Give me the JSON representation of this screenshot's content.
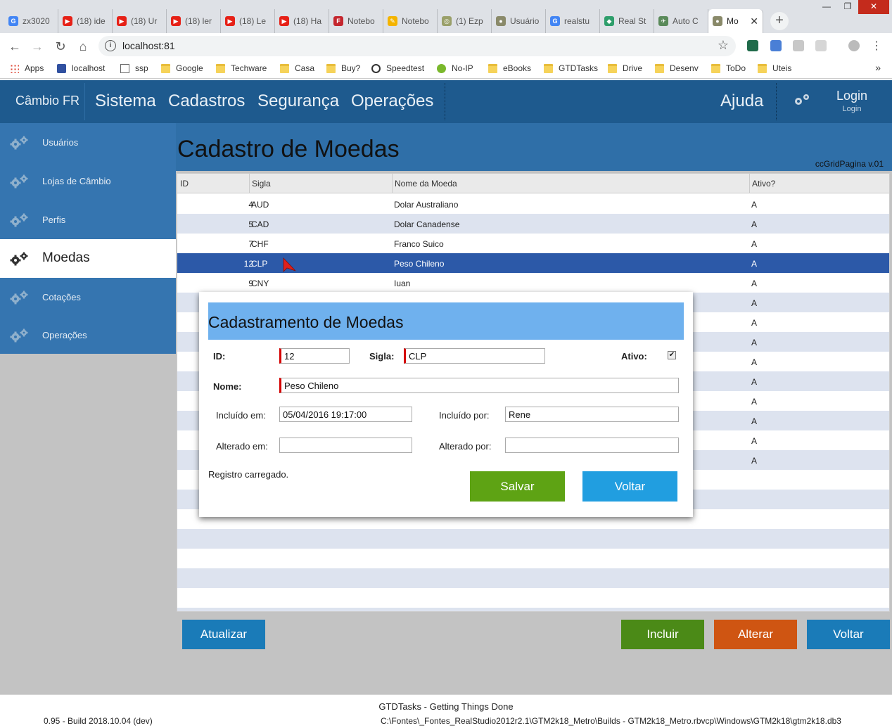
{
  "browser": {
    "window_controls": [
      "—",
      "❐",
      "✕"
    ],
    "tabs": [
      {
        "label": "zx3020",
        "fav_color": "#4285f4",
        "fav_glyph": "G"
      },
      {
        "label": "(18) ide",
        "fav_color": "#e62117",
        "fav_glyph": "▶"
      },
      {
        "label": "(18) Ur",
        "fav_color": "#e62117",
        "fav_glyph": "▶"
      },
      {
        "label": "(18) ler",
        "fav_color": "#e62117",
        "fav_glyph": "▶"
      },
      {
        "label": "(18) Le",
        "fav_color": "#e62117",
        "fav_glyph": "▶"
      },
      {
        "label": "(18) Ha",
        "fav_color": "#e62117",
        "fav_glyph": "▶"
      },
      {
        "label": "Notebo",
        "fav_color": "#c4262e",
        "fav_glyph": "F"
      },
      {
        "label": "Notebo",
        "fav_color": "#f4b400",
        "fav_glyph": "✎"
      },
      {
        "label": "(1) Ezp",
        "fav_color": "#9aa06a",
        "fav_glyph": "◎"
      },
      {
        "label": "Usuário",
        "fav_color": "#8a8a6a",
        "fav_glyph": "●"
      },
      {
        "label": "realstu",
        "fav_color": "#4285f4",
        "fav_glyph": "G"
      },
      {
        "label": "Real St",
        "fav_color": "#2e9e6b",
        "fav_glyph": "◆"
      },
      {
        "label": "Auto C",
        "fav_color": "#5a8a5a",
        "fav_glyph": "✈"
      },
      {
        "label": "Mo",
        "fav_color": "#8a8a6a",
        "fav_glyph": "●",
        "active": true
      }
    ],
    "new_tab": "+",
    "tab_close": "✕",
    "url": "localhost:81",
    "bookmarks": [
      {
        "label": "Apps",
        "type": "appsgrid"
      },
      {
        "label": "localhost",
        "type": "logo"
      },
      {
        "label": "ssp",
        "type": "page"
      },
      {
        "label": "Google",
        "type": "folder"
      },
      {
        "label": "Techware",
        "type": "folder"
      },
      {
        "label": "Casa",
        "type": "folder"
      },
      {
        "label": "Buy?",
        "type": "folder"
      },
      {
        "label": "Speedtest",
        "type": "speed"
      },
      {
        "label": "No-IP",
        "type": "noip"
      },
      {
        "label": "eBooks",
        "type": "folder"
      },
      {
        "label": "GTDTasks",
        "type": "folder"
      },
      {
        "label": "Drive",
        "type": "folder"
      },
      {
        "label": "Desenv",
        "type": "folder"
      },
      {
        "label": "ToDo",
        "type": "folder"
      },
      {
        "label": "Uteis",
        "type": "folder"
      }
    ],
    "bookmarks_more": "»"
  },
  "app": {
    "brand": "Câmbio FR",
    "menu": [
      "Sistema",
      "Cadastros",
      "Segurança",
      "Operações"
    ],
    "help": "Ajuda",
    "login_title": "Login",
    "login_sub": "Login",
    "colors": {
      "header": "#1e5a8e",
      "sidebar": "#3575b0",
      "title_band": "#2f6fa8",
      "selected_row": "#2c59a8"
    }
  },
  "sidebar": {
    "items": [
      {
        "label": "Usuários",
        "active": false
      },
      {
        "label": "Lojas de Câmbio",
        "active": false
      },
      {
        "label": "Perfis",
        "active": false
      },
      {
        "label": "Moedas",
        "active": true
      },
      {
        "label": "Cotações",
        "active": false
      },
      {
        "label": "Operações",
        "active": false
      }
    ]
  },
  "page": {
    "title": "Cadastro de Moedas",
    "grid_version": "ccGridPagina v.01"
  },
  "grid": {
    "columns": [
      "ID",
      "Sigla",
      "Nome da Moeda",
      "Ativo?"
    ],
    "rows": [
      {
        "id": "4",
        "sigla": "AUD",
        "nome": "Dolar Australiano",
        "ativo": "A"
      },
      {
        "id": "5",
        "sigla": "CAD",
        "nome": "Dolar Canadense",
        "ativo": "A"
      },
      {
        "id": "7",
        "sigla": "CHF",
        "nome": "Franco Suico",
        "ativo": "A"
      },
      {
        "id": "12",
        "sigla": "CLP",
        "nome": "Peso Chileno",
        "ativo": "A",
        "selected": true
      },
      {
        "id": "9",
        "sigla": "CNY",
        "nome": "Iuan",
        "ativo": "A"
      },
      {
        "id": "",
        "sigla": "",
        "nome": "",
        "ativo": "A"
      },
      {
        "id": "",
        "sigla": "",
        "nome": "",
        "ativo": "A"
      },
      {
        "id": "",
        "sigla": "",
        "nome": "",
        "ativo": "A"
      },
      {
        "id": "",
        "sigla": "",
        "nome": "",
        "ativo": "A"
      },
      {
        "id": "",
        "sigla": "",
        "nome": "",
        "ativo": "A"
      },
      {
        "id": "",
        "sigla": "",
        "nome": "",
        "ativo": "A"
      },
      {
        "id": "",
        "sigla": "",
        "nome": "",
        "ativo": "A"
      },
      {
        "id": "",
        "sigla": "",
        "nome": "",
        "ativo": "A"
      },
      {
        "id": "",
        "sigla": "",
        "nome": "",
        "ativo": "A"
      }
    ],
    "blank_rows": 8
  },
  "actions": {
    "refresh": "Atualizar",
    "add": "Incluir",
    "edit": "Alterar",
    "back": "Voltar",
    "colors": {
      "refresh": "#1a7bb8",
      "add": "#4b8a17",
      "edit": "#cf5512",
      "back": "#1a7bb8"
    }
  },
  "modal": {
    "title": "Cadastramento de Moedas",
    "id_label": "ID:",
    "id_value": "12",
    "sigla_label": "Sigla:",
    "sigla_value": "CLP",
    "ativo_label": "Ativo:",
    "ativo_checked": true,
    "check_glyph": "✔",
    "nome_label": "Nome:",
    "nome_value": "Peso Chileno",
    "incluido_em_label": "Incluído em:",
    "incluido_em_value": "05/04/2016 19:17:00",
    "incluido_por_label": "Incluído por:",
    "incluido_por_value": "Rene",
    "alterado_em_label": "Alterado em:",
    "alterado_em_value": "",
    "alterado_por_label": "Alterado por:",
    "alterado_por_value": "",
    "status": "Registro carregado.",
    "save": "Salvar",
    "back": "Voltar",
    "colors": {
      "header": "#6fb1ee",
      "save": "#5ea314",
      "back": "#219ee0",
      "required_marker": "#d40000"
    }
  },
  "footer": {
    "app_name": "GTDTasks - Getting Things Done",
    "version": "0.95 - Build 2018.10.04 (dev)",
    "db_path": "C:\\Fontes\\_Fontes_RealStudio2012r2.1\\GTM2k18_Metro\\Builds - GTM2k18_Metro.rbvcp\\Windows\\GTM2k18\\gtm2k18.db3"
  }
}
